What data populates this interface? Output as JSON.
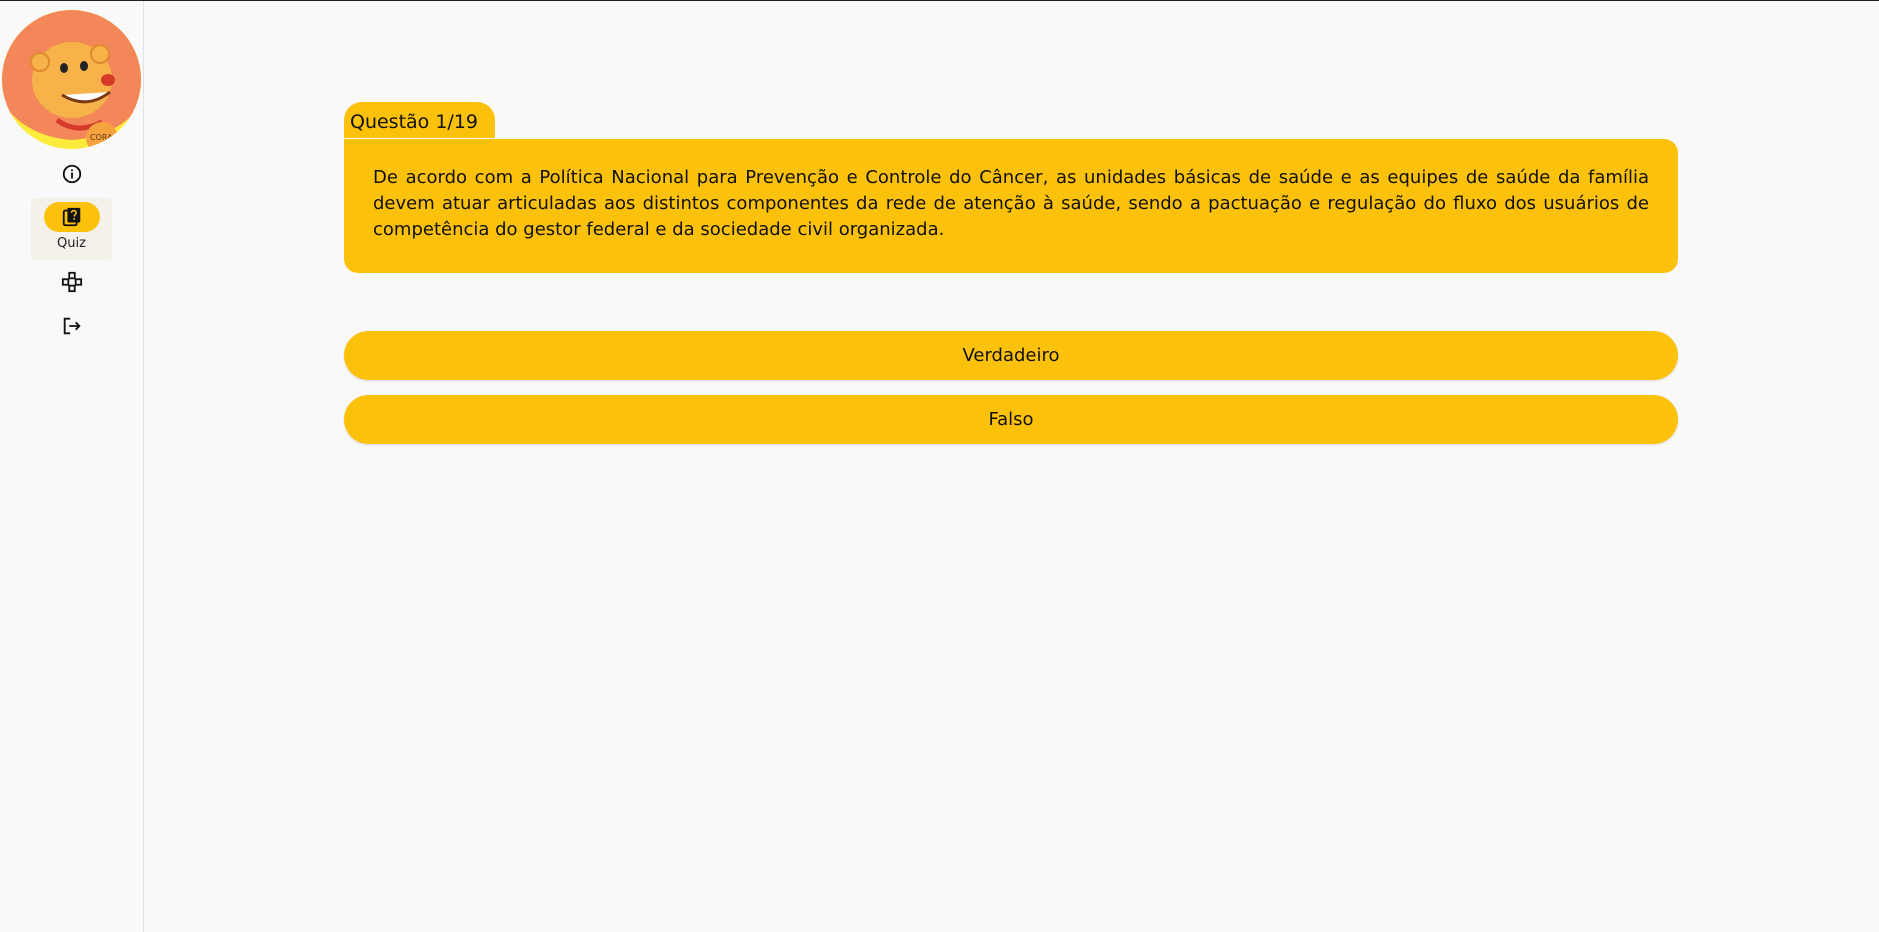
{
  "colors": {
    "accent": "#fcc10a",
    "background": "#f9f9f9"
  },
  "rail": {
    "items": [
      {
        "icon": "info-icon"
      },
      {
        "icon": "quiz-icon",
        "label": "Quiz",
        "active": true
      },
      {
        "icon": "gamepad-icon"
      },
      {
        "icon": "logout-icon"
      }
    ]
  },
  "question": {
    "counter": "Questão 1/19",
    "text": "De acordo com a Política Nacional para Prevenção e Controle do Câncer, as unidades básicas de saúde e as equipes de saúde da família devem atuar articuladas aos distintos componentes da rede de atenção à saúde, sendo a pactuação e regulação do fluxo dos usuários de competência do gestor federal e da sociedade civil organizada."
  },
  "answers": [
    {
      "label": "Verdadeiro"
    },
    {
      "label": "Falso"
    }
  ]
}
